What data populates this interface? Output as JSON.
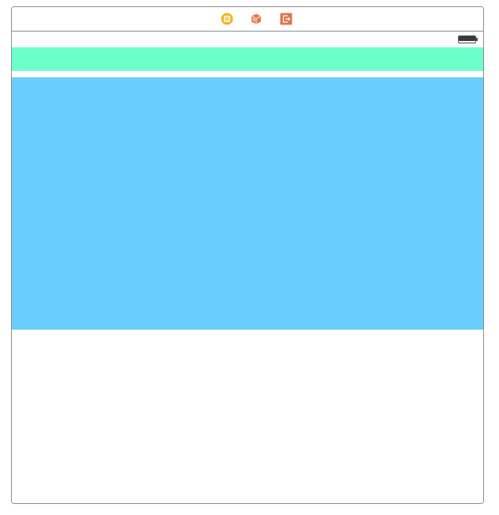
{
  "scene": {
    "dock_icons": [
      "view-controller-icon",
      "first-responder-icon",
      "exit-icon"
    ],
    "status_bar": {
      "battery_level": 1.0
    },
    "views": {
      "green_view": {
        "color": "#6cffcb"
      },
      "blue_view": {
        "color": "#6acdfe"
      }
    }
  },
  "colors": {
    "view_controller_icon": "#f0b41c",
    "first_responder_icon": "#e8784d",
    "exit_icon": "#e0744a",
    "border": "#8e8e8e"
  }
}
